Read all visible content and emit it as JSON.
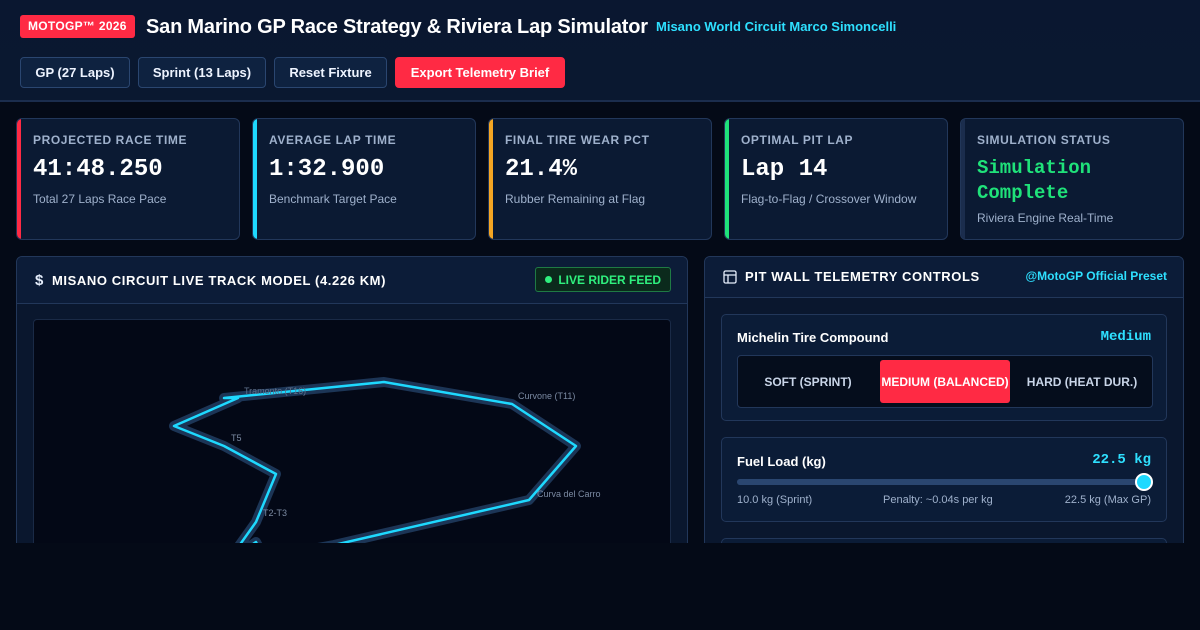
{
  "header": {
    "badge": "MOTOGP™ 2026",
    "title": "San Marino GP Race Strategy & Riviera Lap Simulator",
    "venue": "Misano World Circuit Marco Simoncelli",
    "buttons": {
      "gp": "GP (27 Laps)",
      "sprint": "Sprint (13 Laps)",
      "reset": "Reset Fixture",
      "export": "Export Telemetry Brief"
    }
  },
  "stats": [
    {
      "label": "PROJECTED RACE TIME",
      "value": "41:48.250",
      "sub": "Total 27 Laps Race Pace",
      "accent": "#ff2a44"
    },
    {
      "label": "AVERAGE LAP TIME",
      "value": "1:32.900",
      "sub": "Benchmark Target Pace",
      "accent": "#1ed9ff"
    },
    {
      "label": "FINAL TIRE WEAR PCT",
      "value": "21.4%",
      "sub": "Rubber Remaining at Flag",
      "accent": "#f5a623"
    },
    {
      "label": "OPTIMAL PIT LAP",
      "value": "Lap 14",
      "sub": "Flag-to-Flag / Crossover Window",
      "accent": "#1fe27a"
    },
    {
      "label": "SIMULATION STATUS",
      "value": "Simulation Complete",
      "sub": "Riviera Engine Real-Time",
      "accent": "#1b2d4d"
    }
  ],
  "track_panel": {
    "title": "MISANO CIRCUIT LIVE TRACK MODEL (4.226 KM)",
    "live_badge": "LIVE RIDER FEED",
    "corners": {
      "tramonto": "Tramonto (T16)",
      "curvone": "Curvone (T11)",
      "t5": "T5",
      "carro": "Curva del Carro",
      "t2t3": "T2-T3"
    }
  },
  "controls_panel": {
    "title": "PIT WALL TELEMETRY CONTROLS",
    "preset": "@MotoGP Official Preset",
    "tire": {
      "label": "Michelin Tire Compound",
      "value": "Medium",
      "options": [
        "SOFT (SPRINT)",
        "MEDIUM (BALANCED)",
        "HARD (HEAT DUR.)"
      ],
      "selected_index": 1
    },
    "fuel": {
      "label": "Fuel Load (kg)",
      "value": "22.5 kg",
      "min_label": "10.0 kg (Sprint)",
      "penalty_label": "Penalty: ~0.04s per kg",
      "max_label": "22.5 kg (Max GP)",
      "min": 10.0,
      "max": 22.5,
      "current": 22.5
    }
  },
  "colors": {
    "accent_red": "#ff2a44",
    "accent_cyan": "#1ed9ff",
    "accent_green": "#1fe27a"
  }
}
